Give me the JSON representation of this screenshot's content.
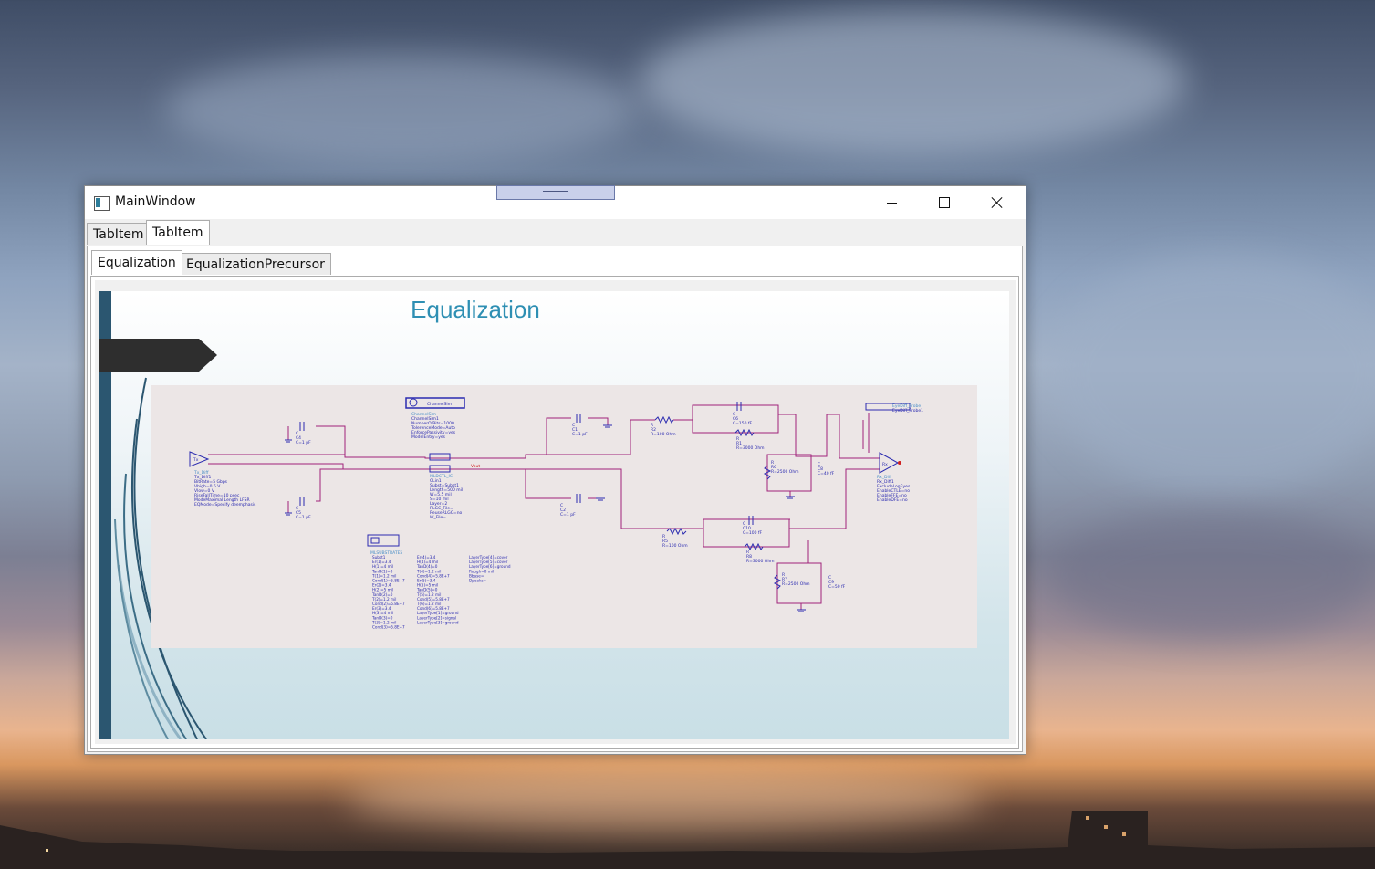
{
  "window": {
    "title": "MainWindow",
    "controls": {
      "minimize": "minimize",
      "maximize": "maximize",
      "close": "close"
    }
  },
  "outer_tabs": [
    {
      "label": "TabItem",
      "selected": false
    },
    {
      "label": "TabItem",
      "selected": true
    }
  ],
  "inner_tabs": [
    {
      "label": "Equalization",
      "selected": true
    },
    {
      "label": "EqualizationPrecursor",
      "selected": false
    }
  ],
  "slide": {
    "title": "Equalization"
  },
  "schematic": {
    "blocks": {
      "channelsim": {
        "header": "ChannelSim",
        "lines": [
          "ChannelSim",
          "ChannelSim1",
          "NumberOfBits=1000",
          "TolerenceMode=Auto",
          "EnforcePassivity=yes",
          "ModelEntry=yes"
        ]
      },
      "tx": {
        "label": "Tx",
        "lines": [
          "Tx_Diff",
          "Tx_Diff1",
          "BitRate=5 Gbps",
          "Vhigh=0.5 V",
          "Vlow=0 V",
          "RiseFallTime=10 psec",
          "ModeMaximal Length LFSR",
          "EQMode=Specify deemphasis"
        ]
      },
      "rx": {
        "label": "Rx",
        "lines": [
          "Rx_Diff",
          "Rx_Diff1",
          "ExcludeLogEyes",
          "EnableCTLE=no",
          "EnableFFE=no",
          "EnableDFE=no"
        ]
      },
      "eyediff": {
        "lines": [
          "EyeDiff_Probe",
          "EyeDiff_Probe1"
        ]
      },
      "mlin": {
        "lines": [
          "MLDCTL_IC",
          "CLin1",
          "Subst=Subst1",
          "Length=500 mil",
          "W=5.5 mil",
          "S=10 mil",
          "Layer=2",
          "RLGC_File=",
          "ReuseRLGC=no",
          "W_File="
        ]
      },
      "vout": "Vout",
      "msub": {
        "header": "MLSUBSTRATE5",
        "col1": [
          "Subst1",
          "Er(1)=3.4",
          "H(1)=4 mil",
          "TanD(1)=0",
          "T(1)=1.2 mil",
          "Cond(1)=5.8E+7",
          "Er(2)=3.4",
          "H(2)=5 mil",
          "TanD(2)=0",
          "T(2)=1.2 mil",
          "Cond(2)=5.8E+7",
          "Er(3)=3.4",
          "H(3)=4 mil",
          "TanD(3)=0",
          "T(3)=1.2 mil",
          "Cond(3)=5.8E+7"
        ],
        "col2": [
          "Er(4)=3.4",
          "H(4)=4 mil",
          "TanD(4)=0",
          "T(4)=1.2 mil",
          "Cond(4)=5.8E+7",
          "Er(5)=3.4",
          "H(5)=5 mil",
          "TanD(5)=0",
          "T(5)=1.2 mil",
          "Cond(5)=5.8E+7",
          "T(6)=1.2 mil",
          "Cond(6)=5.8E+7",
          "LayerType[1]=ground",
          "LayerType[2]=signal",
          "LayerType[3]=ground"
        ],
        "col3": [
          "LayerType[4]=cover",
          "LayerType[5]=cover",
          "LayerType[6]=ground",
          "Rough=0 mil",
          "Bbase=",
          "Dpeaks="
        ]
      },
      "caps": [
        {
          "name": "C",
          "id": "C4",
          "value": "C=1 pF"
        },
        {
          "name": "C",
          "id": "C5",
          "value": "C=1 pF"
        },
        {
          "name": "C",
          "id": "C1",
          "value": "C=1 pF"
        },
        {
          "name": "C",
          "id": "C2",
          "value": "C=1 pF"
        }
      ],
      "eq_top": {
        "r_series": [
          "R",
          "R2",
          "R=100 Ohm"
        ],
        "c_par": [
          "C",
          "C6",
          "C=150 fF"
        ],
        "r_par": [
          "R",
          "R1",
          "R=3000 Ohm"
        ],
        "r_shunt": [
          "R",
          "R6",
          "R=2500 Ohm"
        ],
        "c_shunt": [
          "C",
          "C8",
          "C=40 fF"
        ]
      },
      "eq_bot": {
        "r_series": [
          "R",
          "R5",
          "R=100 Ohm"
        ],
        "c_par": [
          "C",
          "C10",
          "C=100 fF"
        ],
        "r_par": [
          "R",
          "R8",
          "R=3000 Ohm"
        ],
        "r_shunt": [
          "R",
          "R7",
          "R=2500 Ohm"
        ],
        "c_shunt": [
          "C",
          "C9",
          "C=50 fF"
        ]
      }
    }
  },
  "colors": {
    "slide_title": "#2e8fb3",
    "slide_bar": "#2b5670",
    "wire": "#a0237a",
    "component": "#2b2bb0",
    "schematic_bg": "#ece6e6"
  }
}
